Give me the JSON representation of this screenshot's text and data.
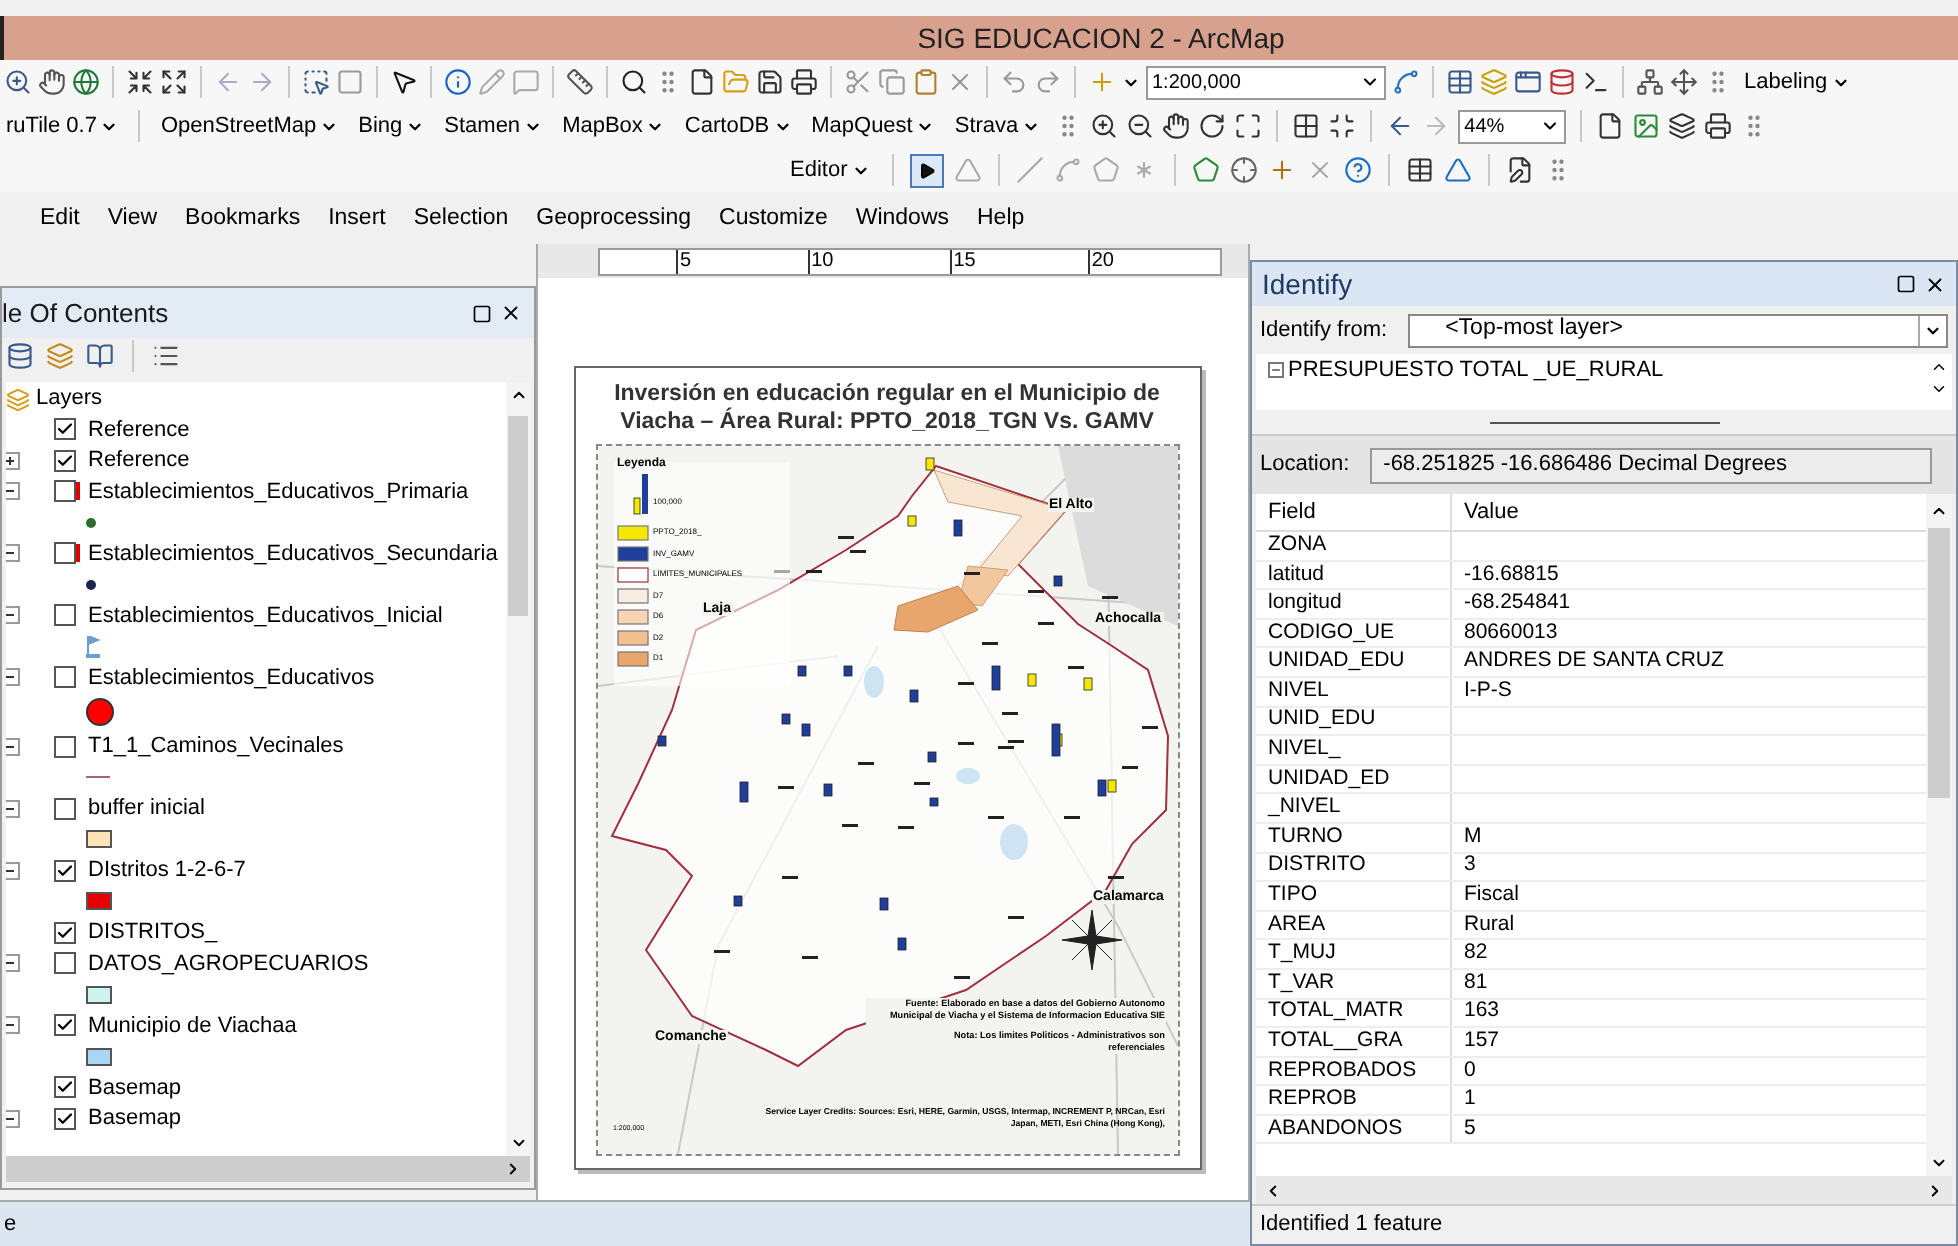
{
  "window": {
    "title": "SIG EDUCACION 2 - ArcMap"
  },
  "toolbars": {
    "scale": "1:200,000",
    "labeling": "Labeling",
    "tile_menu": "ruTile 0.7",
    "basemap_menus": [
      "OpenStreetMap",
      "Bing",
      "Stamen",
      "MapBox",
      "CartoDB",
      "MapQuest",
      "Strava"
    ],
    "zoom": "44%",
    "editor": "Editor"
  },
  "menu": [
    "Edit",
    "View",
    "Bookmarks",
    "Insert",
    "Selection",
    "Geoprocessing",
    "Customize",
    "Windows",
    "Help"
  ],
  "toc": {
    "title": "le Of Contents",
    "root": "Layers",
    "layers": [
      {
        "name": "Reference",
        "checked": true,
        "broken": false
      },
      {
        "name": "Reference",
        "checked": true,
        "broken": false,
        "expanded": false
      },
      {
        "name": "Establecimientos_Educativos_Primaria",
        "checked": false,
        "broken": true,
        "expanded": true,
        "symbol": {
          "kind": "dot",
          "color": "#2e6b2e"
        }
      },
      {
        "name": "Establecimientos_Educativos_Secundaria",
        "checked": false,
        "broken": true,
        "expanded": true,
        "symbol": {
          "kind": "dot",
          "color": "#1c2454"
        }
      },
      {
        "name": "Establecimientos_Educativos_Inicial",
        "checked": false,
        "broken": false,
        "expanded": true,
        "symbol": {
          "kind": "flag",
          "color": "#6a9fd4"
        }
      },
      {
        "name": "Establecimientos_Educativos",
        "checked": false,
        "broken": false,
        "expanded": true,
        "symbol": {
          "kind": "circle",
          "color": "#ff0000"
        }
      },
      {
        "name": "T1_1_Caminos_Vecinales",
        "checked": false,
        "broken": false,
        "expanded": true,
        "symbol": {
          "kind": "line",
          "color": "#b0606e"
        }
      },
      {
        "name": "buffer inicial",
        "checked": false,
        "broken": false,
        "expanded": true,
        "symbol": {
          "kind": "fill",
          "color": "#fde4b8"
        }
      },
      {
        "name": "DIstritos 1-2-6-7",
        "checked": true,
        "broken": false,
        "expanded": true,
        "symbol": {
          "kind": "fill",
          "color": "#e60000"
        }
      },
      {
        "name": "DISTRITOS_",
        "checked": true,
        "broken": false
      },
      {
        "name": "DATOS_AGROPECUARIOS",
        "checked": false,
        "broken": false,
        "expanded": true,
        "symbol": {
          "kind": "fill",
          "color": "#cdf3ef"
        }
      },
      {
        "name": "Municipio de Viachaa",
        "checked": true,
        "broken": false,
        "expanded": true,
        "symbol": {
          "kind": "fill",
          "color": "#a9d6f5"
        }
      },
      {
        "name": "Basemap",
        "checked": true,
        "broken": false
      },
      {
        "name": "Basemap",
        "checked": true,
        "broken": false,
        "expanded": true
      }
    ]
  },
  "layout": {
    "ruler": [
      "5",
      "10",
      "15",
      "20"
    ],
    "title": "Inversión en educación regular en el Municipio de Viacha – Área Rural: PPTO_2018_TGN Vs. GAMV",
    "legend": {
      "title": "Leyenda",
      "size_label": "100,000",
      "items": [
        "PPTO_2018_",
        "INV_GAMV",
        "LIMITES_MUNICIPALES",
        "D7",
        "D6",
        "D2",
        "D1"
      ]
    },
    "places": [
      "El Alto",
      "Laja",
      "Achocalla",
      "Calamarca",
      "Comanche"
    ],
    "source": "Fuente: Elaborado en base a datos del Gobierno Autonomo Municipal de Viacha y el Sistema de Informacion Educativa SIE",
    "note": "Nota: Los limites Politicos - Administrativos son referenciales",
    "credits": "Service Layer Credits: Sources: Esri, HERE, Garmin, USGS, Intermap, INCREMENT P, NRCan, Esri Japan, METI, Esri China (Hong Kong),",
    "scale": "1:200,000"
  },
  "identify": {
    "title": "Identify",
    "from_label": "Identify from:",
    "from_value": "<Top-most layer>",
    "tree_item": "PRESUPUESTO TOTAL _UE_RURAL",
    "location_label": "Location:",
    "location": "-68.251825  -16.686486 Decimal Degrees",
    "columns": [
      "Field",
      "Value"
    ],
    "rows": [
      {
        "field": "ZONA"
      },
      {
        "field": "latitud",
        "value": "-16.68815"
      },
      {
        "field": "longitud",
        "value": "-68.254841"
      },
      {
        "field": "CODIGO_UE",
        "value": "80660013"
      },
      {
        "field": "UNIDAD_EDU",
        "value": "ANDRES DE SANTA CRUZ"
      },
      {
        "field": "NIVEL",
        "value": "I-P-S"
      },
      {
        "field": "UNID_EDU"
      },
      {
        "field": "NIVEL_"
      },
      {
        "field": "UNIDAD_ED"
      },
      {
        "field": "_NIVEL"
      },
      {
        "field": "TURNO",
        "value": "M"
      },
      {
        "field": "DISTRITO",
        "value": "3"
      },
      {
        "field": "TIPO",
        "value": "Fiscal"
      },
      {
        "field": "AREA",
        "value": "Rural"
      },
      {
        "field": "T_MUJ",
        "value": "82"
      },
      {
        "field": "T_VAR",
        "value": "81"
      },
      {
        "field": "TOTAL_MATR",
        "value": "163"
      },
      {
        "field": "TOTAL__GRA",
        "value": "157"
      },
      {
        "field": "REPROBADOS",
        "value": "0"
      },
      {
        "field": "REPROB",
        "value": "1"
      },
      {
        "field": "ABANDONOS",
        "value": "5"
      }
    ],
    "status": "Identified 1 feature"
  },
  "status_bar": "e"
}
